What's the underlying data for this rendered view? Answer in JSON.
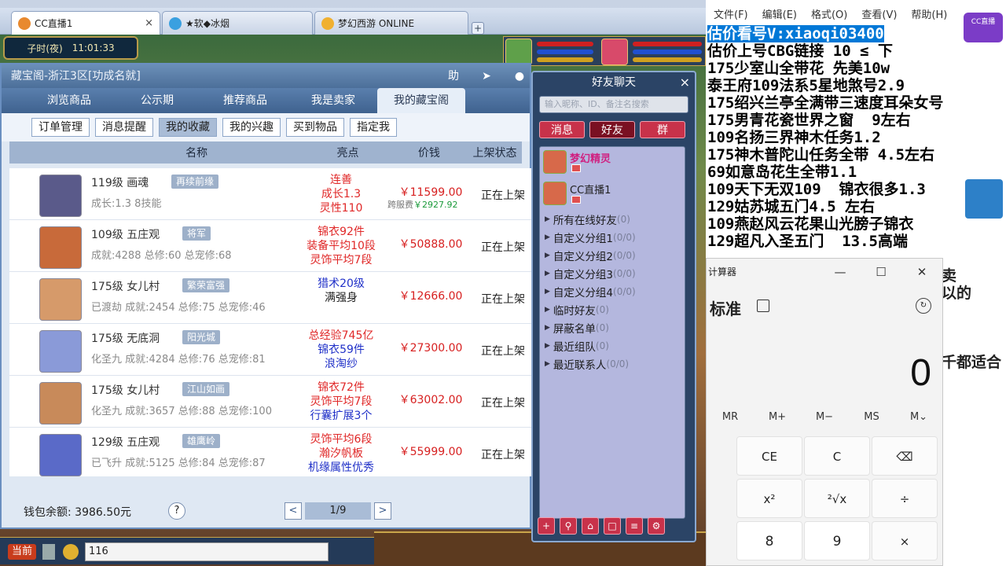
{
  "browser": {
    "tabs": [
      {
        "label": "CC直播1",
        "close": "×",
        "active": true,
        "color": "#e8892e"
      },
      {
        "label": "★软◆冰烟",
        "close": "",
        "active": false,
        "color": "#3aa0e0"
      },
      {
        "label": "梦幻西游 ONLINE",
        "close": "",
        "active": false,
        "color": "#f0b030"
      }
    ],
    "new_tab": "+"
  },
  "game": {
    "clock_period": "子时(夜)",
    "clock_time": "11:01:33"
  },
  "cbg": {
    "title": "藏宝阁-浙江3区[功成名就]",
    "help_btn": "助",
    "tabs": [
      "浏览商品",
      "公示期",
      "推荐商品",
      "我是卖家",
      "我的藏宝阁"
    ],
    "subtabs": [
      "订单管理",
      "消息提醒",
      "我的收藏",
      "我的兴趣",
      "买到物品",
      "指定我"
    ],
    "columns": [
      "名称",
      "亮点",
      "价钱",
      "上架状态"
    ],
    "rows": [
      {
        "level": "119级",
        "school": "画魂",
        "tag": "再续前缘",
        "detail": "成长:1.3 8技能",
        "highlights": [
          {
            "t": "连善",
            "c": "#e02828"
          },
          {
            "t": "成长1.3",
            "c": "#e02828"
          },
          {
            "t": "灵性110",
            "c": "#e02828"
          }
        ],
        "price": "￥11599.00",
        "cross_label": "跨服费",
        "cross_price": "￥2927.92",
        "status": "正在上架",
        "avatar": "#5a5a8a"
      },
      {
        "level": "109级",
        "school": "五庄观",
        "tag": "将军",
        "detail": "成就:4288 总修:60 总宠修:68",
        "highlights": [
          {
            "t": "锦衣92件",
            "c": "#e02828"
          },
          {
            "t": "装备平均10段",
            "c": "#e02828"
          },
          {
            "t": "灵饰平均7段",
            "c": "#e02828"
          }
        ],
        "price": "￥50888.00",
        "cross_label": "",
        "cross_price": "",
        "status": "正在上架",
        "avatar": "#c86a3a"
      },
      {
        "level": "175级",
        "school": "女儿村",
        "tag": "繁荣富强",
        "detail": "已渡劫 成就:2454 总修:75 总宠修:46",
        "highlights": [
          {
            "t": "猎术20级",
            "c": "#2030c8"
          },
          {
            "t": "满强身",
            "c": "#222222"
          }
        ],
        "price": "￥12666.00",
        "cross_label": "",
        "cross_price": "",
        "status": "正在上架",
        "avatar": "#d69a6a"
      },
      {
        "level": "175级",
        "school": "无底洞",
        "tag": "阳光城",
        "detail": "化圣九 成就:4284 总修:76 总宠修:81",
        "highlights": [
          {
            "t": "总经验745亿",
            "c": "#e02828"
          },
          {
            "t": "锦衣59件",
            "c": "#2030c8"
          },
          {
            "t": "浪淘纱",
            "c": "#2030c8"
          }
        ],
        "price": "￥27300.00",
        "cross_label": "",
        "cross_price": "",
        "status": "正在上架",
        "avatar": "#8a9ad8"
      },
      {
        "level": "175级",
        "school": "女儿村",
        "tag": "江山如画",
        "detail": "化圣九 成就:3657 总修:88 总宠修:100",
        "highlights": [
          {
            "t": "锦衣72件",
            "c": "#e02828"
          },
          {
            "t": "灵饰平均7段",
            "c": "#e02828"
          },
          {
            "t": "行囊扩展3个",
            "c": "#2030c8"
          }
        ],
        "price": "￥63002.00",
        "cross_label": "",
        "cross_price": "",
        "status": "正在上架",
        "avatar": "#c88a5a"
      },
      {
        "level": "129级",
        "school": "五庄观",
        "tag": "雄鹰岭",
        "detail": "已飞升 成就:5125 总修:84 总宠修:87",
        "highlights": [
          {
            "t": "灵饰平均6段",
            "c": "#e02828"
          },
          {
            "t": "瀚汐帆板",
            "c": "#e02828"
          },
          {
            "t": "机缘属性优秀",
            "c": "#2030c8"
          }
        ],
        "price": "￥55999.00",
        "cross_label": "",
        "cross_price": "",
        "status": "正在上架",
        "avatar": "#5a6ac8"
      }
    ],
    "wallet": "钱包余额: 3986.50元",
    "help": "?",
    "page": "1/9",
    "prev": "<",
    "next": ">"
  },
  "chat": {
    "channel": "当前",
    "input_value": "116"
  },
  "friends": {
    "title": "好友聊天",
    "close": "×",
    "search_placeholder": "输入昵称、ID、备注名搜索",
    "tabs": [
      "消息",
      "好友",
      "群"
    ],
    "people": [
      {
        "name": "梦幻精灵",
        "color": "#d02080"
      },
      {
        "name": "CC直播1",
        "color": "#1a1a1a"
      }
    ],
    "groups": [
      {
        "label": "所有在线好友",
        "count": "(0)"
      },
      {
        "label": "自定义分组1",
        "count": "(0/0)"
      },
      {
        "label": "自定义分组2",
        "count": "(0/0)"
      },
      {
        "label": "自定义分组3",
        "count": "(0/0)"
      },
      {
        "label": "自定义分组4",
        "count": "(0/0)"
      },
      {
        "label": "临时好友",
        "count": "(0)"
      },
      {
        "label": "屏蔽名单",
        "count": "(0)"
      },
      {
        "label": "最近组队",
        "count": "(0)"
      },
      {
        "label": "最近联系人",
        "count": "(0/0)"
      }
    ]
  },
  "notepad": {
    "menu": [
      "文件(F)",
      "编辑(E)",
      "格式(O)",
      "查看(V)",
      "帮助(H)"
    ],
    "selected_line": "估价看号V:xiaoqi03400",
    "lines": [
      "估价上号CBG链接 10 ≤ 下",
      "175少室山全带花 先美10w",
      "泰王府109法系5星地煞号2.9",
      "175绍兴兰亭全满带三速度耳朵女号",
      "175男青花瓷世界之窗  9左右",
      "109名扬三界神木任务1.2",
      "175神木普陀山任务全带 4.5左右",
      "69如意岛花生全带1.1",
      "109天下无双109  锦衣很多1.3",
      "129姑苏城五门4.5 左右",
      "109燕赵风云花果山光膀子锦衣",
      "129超凡入圣五门  13.5高端"
    ],
    "hidden_tail": [
      "卖",
      "以的",
      "",
      "",
      "",
      "千都适合"
    ],
    "logo_text": "CC直播"
  },
  "calculator": {
    "title": "计算器",
    "mode": "标准",
    "display": "0",
    "memory": [
      "MR",
      "M+",
      "M−",
      "MS",
      "M⌄"
    ],
    "keys": [
      "CE",
      "C",
      "⌫",
      "x²",
      "²√x",
      "÷",
      "8",
      "9",
      "×"
    ],
    "win_ctrls": [
      "—",
      "☐",
      "✕"
    ]
  }
}
